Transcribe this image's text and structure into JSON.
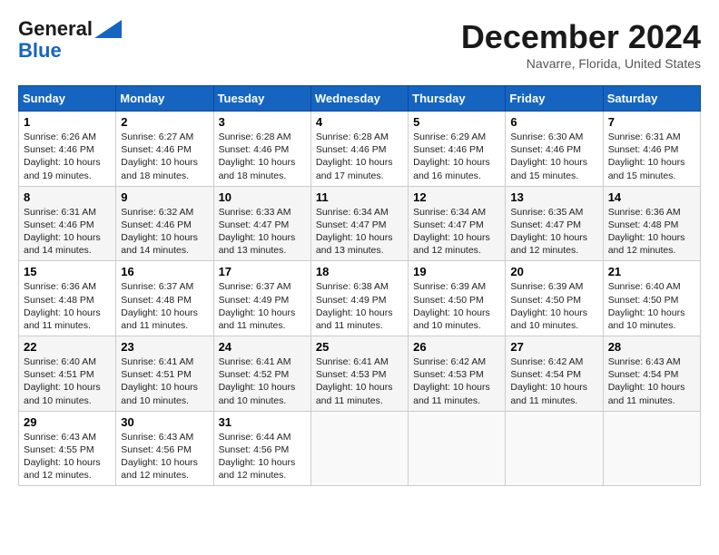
{
  "header": {
    "logo_general": "General",
    "logo_blue": "Blue",
    "title": "December 2024",
    "location": "Navarre, Florida, United States"
  },
  "weekdays": [
    "Sunday",
    "Monday",
    "Tuesday",
    "Wednesday",
    "Thursday",
    "Friday",
    "Saturday"
  ],
  "weeks": [
    [
      {
        "day": "1",
        "info": "Sunrise: 6:26 AM\nSunset: 4:46 PM\nDaylight: 10 hours\nand 19 minutes."
      },
      {
        "day": "2",
        "info": "Sunrise: 6:27 AM\nSunset: 4:46 PM\nDaylight: 10 hours\nand 18 minutes."
      },
      {
        "day": "3",
        "info": "Sunrise: 6:28 AM\nSunset: 4:46 PM\nDaylight: 10 hours\nand 18 minutes."
      },
      {
        "day": "4",
        "info": "Sunrise: 6:28 AM\nSunset: 4:46 PM\nDaylight: 10 hours\nand 17 minutes."
      },
      {
        "day": "5",
        "info": "Sunrise: 6:29 AM\nSunset: 4:46 PM\nDaylight: 10 hours\nand 16 minutes."
      },
      {
        "day": "6",
        "info": "Sunrise: 6:30 AM\nSunset: 4:46 PM\nDaylight: 10 hours\nand 15 minutes."
      },
      {
        "day": "7",
        "info": "Sunrise: 6:31 AM\nSunset: 4:46 PM\nDaylight: 10 hours\nand 15 minutes."
      }
    ],
    [
      {
        "day": "8",
        "info": "Sunrise: 6:31 AM\nSunset: 4:46 PM\nDaylight: 10 hours\nand 14 minutes."
      },
      {
        "day": "9",
        "info": "Sunrise: 6:32 AM\nSunset: 4:46 PM\nDaylight: 10 hours\nand 14 minutes."
      },
      {
        "day": "10",
        "info": "Sunrise: 6:33 AM\nSunset: 4:47 PM\nDaylight: 10 hours\nand 13 minutes."
      },
      {
        "day": "11",
        "info": "Sunrise: 6:34 AM\nSunset: 4:47 PM\nDaylight: 10 hours\nand 13 minutes."
      },
      {
        "day": "12",
        "info": "Sunrise: 6:34 AM\nSunset: 4:47 PM\nDaylight: 10 hours\nand 12 minutes."
      },
      {
        "day": "13",
        "info": "Sunrise: 6:35 AM\nSunset: 4:47 PM\nDaylight: 10 hours\nand 12 minutes."
      },
      {
        "day": "14",
        "info": "Sunrise: 6:36 AM\nSunset: 4:48 PM\nDaylight: 10 hours\nand 12 minutes."
      }
    ],
    [
      {
        "day": "15",
        "info": "Sunrise: 6:36 AM\nSunset: 4:48 PM\nDaylight: 10 hours\nand 11 minutes."
      },
      {
        "day": "16",
        "info": "Sunrise: 6:37 AM\nSunset: 4:48 PM\nDaylight: 10 hours\nand 11 minutes."
      },
      {
        "day": "17",
        "info": "Sunrise: 6:37 AM\nSunset: 4:49 PM\nDaylight: 10 hours\nand 11 minutes."
      },
      {
        "day": "18",
        "info": "Sunrise: 6:38 AM\nSunset: 4:49 PM\nDaylight: 10 hours\nand 11 minutes."
      },
      {
        "day": "19",
        "info": "Sunrise: 6:39 AM\nSunset: 4:50 PM\nDaylight: 10 hours\nand 10 minutes."
      },
      {
        "day": "20",
        "info": "Sunrise: 6:39 AM\nSunset: 4:50 PM\nDaylight: 10 hours\nand 10 minutes."
      },
      {
        "day": "21",
        "info": "Sunrise: 6:40 AM\nSunset: 4:50 PM\nDaylight: 10 hours\nand 10 minutes."
      }
    ],
    [
      {
        "day": "22",
        "info": "Sunrise: 6:40 AM\nSunset: 4:51 PM\nDaylight: 10 hours\nand 10 minutes."
      },
      {
        "day": "23",
        "info": "Sunrise: 6:41 AM\nSunset: 4:51 PM\nDaylight: 10 hours\nand 10 minutes."
      },
      {
        "day": "24",
        "info": "Sunrise: 6:41 AM\nSunset: 4:52 PM\nDaylight: 10 hours\nand 10 minutes."
      },
      {
        "day": "25",
        "info": "Sunrise: 6:41 AM\nSunset: 4:53 PM\nDaylight: 10 hours\nand 11 minutes."
      },
      {
        "day": "26",
        "info": "Sunrise: 6:42 AM\nSunset: 4:53 PM\nDaylight: 10 hours\nand 11 minutes."
      },
      {
        "day": "27",
        "info": "Sunrise: 6:42 AM\nSunset: 4:54 PM\nDaylight: 10 hours\nand 11 minutes."
      },
      {
        "day": "28",
        "info": "Sunrise: 6:43 AM\nSunset: 4:54 PM\nDaylight: 10 hours\nand 11 minutes."
      }
    ],
    [
      {
        "day": "29",
        "info": "Sunrise: 6:43 AM\nSunset: 4:55 PM\nDaylight: 10 hours\nand 12 minutes."
      },
      {
        "day": "30",
        "info": "Sunrise: 6:43 AM\nSunset: 4:56 PM\nDaylight: 10 hours\nand 12 minutes."
      },
      {
        "day": "31",
        "info": "Sunrise: 6:44 AM\nSunset: 4:56 PM\nDaylight: 10 hours\nand 12 minutes."
      },
      null,
      null,
      null,
      null
    ]
  ]
}
